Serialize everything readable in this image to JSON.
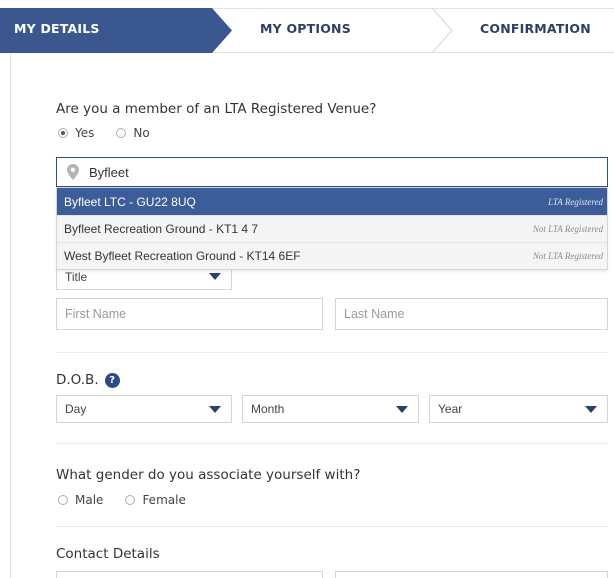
{
  "steps": {
    "step1": "MY DETAILS",
    "step2": "MY OPTIONS",
    "step3": "CONFIRMATION"
  },
  "membership": {
    "question": "Are you a member of an LTA Registered Venue?",
    "options": [
      "Yes",
      "No"
    ],
    "selected": "Yes"
  },
  "venue_search": {
    "value": "Byfleet",
    "results": [
      {
        "name": "Byfleet LTC - GU22 8UQ",
        "tag": "LTA Registered"
      },
      {
        "name": "Byfleet Recreation Ground - KT1 4 7",
        "tag": "Not LTA Registered"
      },
      {
        "name": "West Byfleet Recreation Ground - KT14 6EF",
        "tag": "Not LTA Registered"
      }
    ]
  },
  "name": {
    "title_select": "Title",
    "first_name_placeholder": "First Name",
    "last_name_placeholder": "Last Name"
  },
  "dob": {
    "label": "D.O.B.",
    "help": "?",
    "day": "Day",
    "month": "Month",
    "year": "Year"
  },
  "gender": {
    "question": "What gender do you associate yourself with?",
    "options": [
      "Male",
      "Female"
    ]
  },
  "contact": {
    "heading": "Contact Details"
  },
  "colors": {
    "step_active": "#3a5790",
    "step_text": "#2c3f66",
    "highlight": "#3c5d99"
  }
}
